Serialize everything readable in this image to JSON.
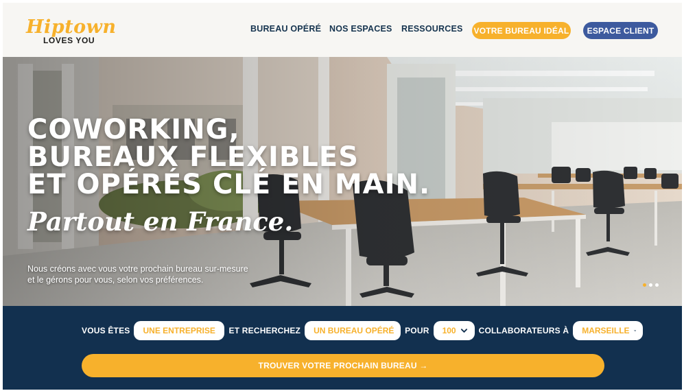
{
  "header": {
    "logo_main": "Hiptown",
    "logo_sub": "LOVES YOU",
    "nav": [
      "BUREAU OPÉRÉ",
      "NOS ESPACES",
      "RESSOURCES"
    ],
    "cta_primary": "VOTRE BUREAU IDÉAL",
    "cta_secondary": "ESPACE CLIENT"
  },
  "hero": {
    "title_lines": [
      "COWORKING,",
      "BUREAUX FLEXIBLES",
      "ET OPÉRÉS CLÉ EN MAIN."
    ],
    "script": "Partout en France.",
    "description_lines": [
      "Nous créons avec vous votre prochain bureau sur-mesure",
      "et le gérons pour vous, selon vos préférences."
    ],
    "slides": 3,
    "active_slide": 1
  },
  "search": {
    "label_you_are": "VOUS ÊTES",
    "value_you_are": "UNE ENTREPRISE",
    "label_looking": "ET RECHERCHEZ",
    "value_looking": "UN BUREAU OPÉRÉ",
    "label_for": "POUR",
    "value_count": "100",
    "label_collab": "COLLABORATEURS À",
    "value_city": "MARSEILLE",
    "submit": "TROUVER VOTRE PROCHAIN BUREAU →"
  },
  "colors": {
    "brand_yellow": "#f7b12c",
    "navy": "#12304f",
    "blue_button": "#3d5a9e"
  }
}
